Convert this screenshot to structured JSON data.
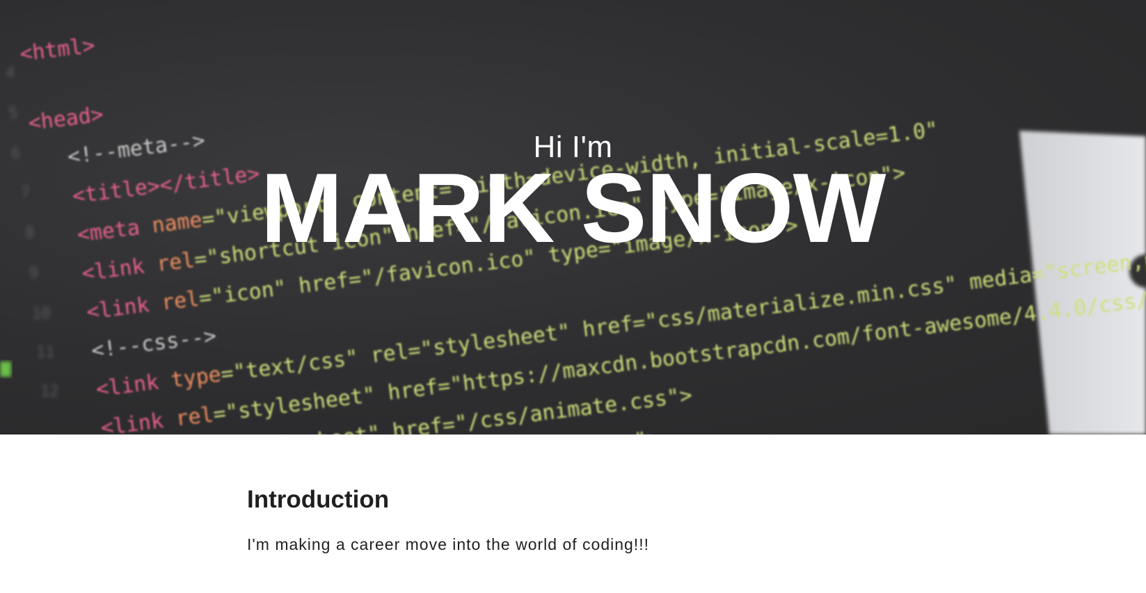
{
  "hero": {
    "greeting": "Hi I'm",
    "name": "MARK SNOW",
    "background_image": "code-editor-screenshot"
  },
  "intro": {
    "heading": "Introduction",
    "text": "I'm making a career move into the world of coding!!!"
  },
  "colors": {
    "hero_background": "#2e2e30",
    "hero_text": "#ffffff",
    "body_text": "#1f1f1f",
    "page_background": "#ffffff"
  }
}
